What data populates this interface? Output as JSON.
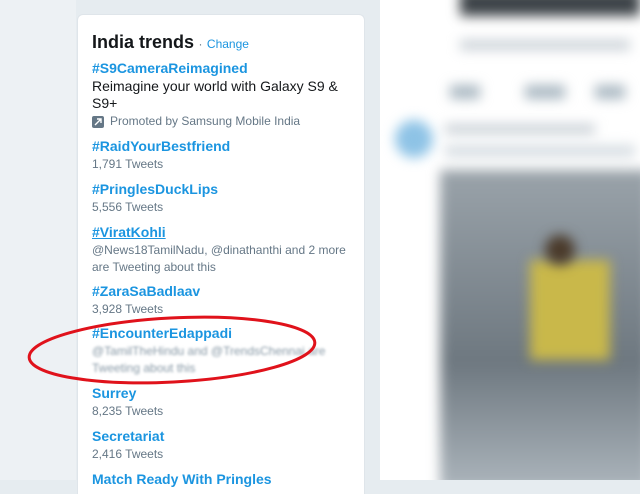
{
  "panel": {
    "title": "India trends",
    "separator": "·",
    "change_label": "Change"
  },
  "trends": [
    {
      "name": "#S9CameraReimagined",
      "description": "Reimagine your world with Galaxy S9 & S9+",
      "promoted_by": "Promoted by Samsung Mobile India"
    },
    {
      "name": "#RaidYourBestfriend",
      "meta": "1,791 Tweets"
    },
    {
      "name": "#PringlesDuckLips",
      "meta": "5,556 Tweets"
    },
    {
      "name": "#ViratKohli",
      "meta": "@News18TamilNadu, @dinathanthi and 2 more are Tweeting about this"
    },
    {
      "name": "#ZaraSaBadlaav",
      "meta": "3,928 Tweets"
    },
    {
      "name": "#EncounterEdappadi",
      "meta": "@TamilTheHindu and @TrendsChennai are Tweeting about this"
    },
    {
      "name": "Surrey",
      "meta": "8,235 Tweets"
    },
    {
      "name": "Secretariat",
      "meta": "2,416 Tweets"
    },
    {
      "name": "Match Ready With Pringles"
    }
  ],
  "icons": {
    "promoted": "promoted-arrow-icon"
  },
  "colors": {
    "link": "#1b95e0",
    "text": "#14171a",
    "muted": "#657786",
    "annotation": "#e0121b"
  }
}
